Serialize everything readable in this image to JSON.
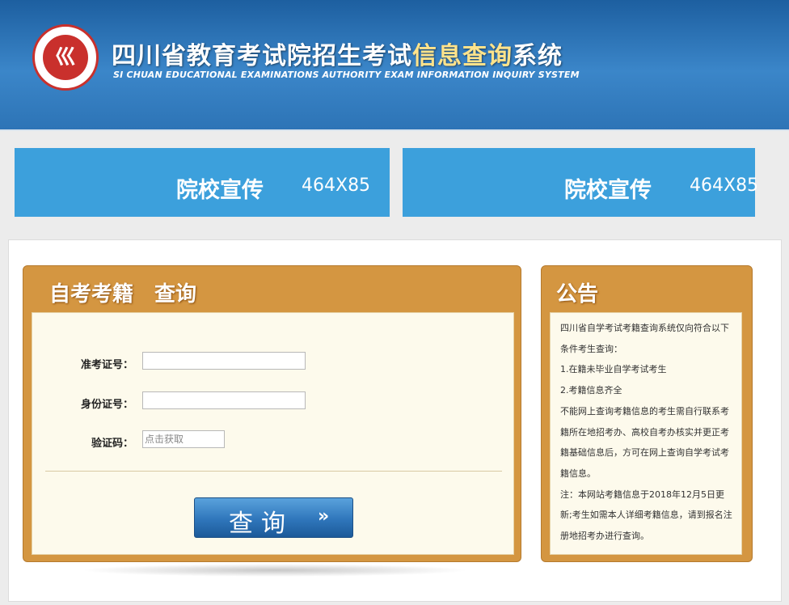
{
  "header": {
    "title_part1": "四川省教育考试院招生考试",
    "title_highlight": "信息查询",
    "title_part2": "系统",
    "title_en": "SI CHUAN EDUCATIONAL EXAMINATIONS AUTHORITY EXAM INFORMATION INQUIRY SYSTEM",
    "logo_glyph": "巛",
    "brand_color": "#2b6fb0",
    "highlight_color": "#ffe38b"
  },
  "banners": [
    {
      "title": "院校宣传",
      "size": "464X85"
    },
    {
      "title": "院校宣传",
      "size": "464X85"
    }
  ],
  "query_panel": {
    "title": "自考考籍　查询",
    "fields": {
      "exam_id": {
        "label": "准考证号：",
        "value": ""
      },
      "id_card": {
        "label": "身份证号：",
        "value": ""
      },
      "captcha": {
        "label": "验证码：",
        "placeholder": "点击获取"
      }
    },
    "submit_label": "查询",
    "submit_arrow": "»",
    "panel_color": "#d49641"
  },
  "notice": {
    "title": "公告",
    "paragraphs": [
      "四川省自学考试考籍查询系统仅向符合以下条件考生查询：",
      "1.在籍未毕业自学考试考生",
      "2.考籍信息齐全",
      "不能网上查询考籍信息的考生需自行联系考籍所在地招考办、高校自考办核实并更正考籍基础信息后，方可在网上查询自学考试考籍信息。",
      "注：本网站考籍信息于2018年12月5日更新;考生如需本人详细考籍信息，请到报名注册地招考办进行查询。"
    ]
  }
}
